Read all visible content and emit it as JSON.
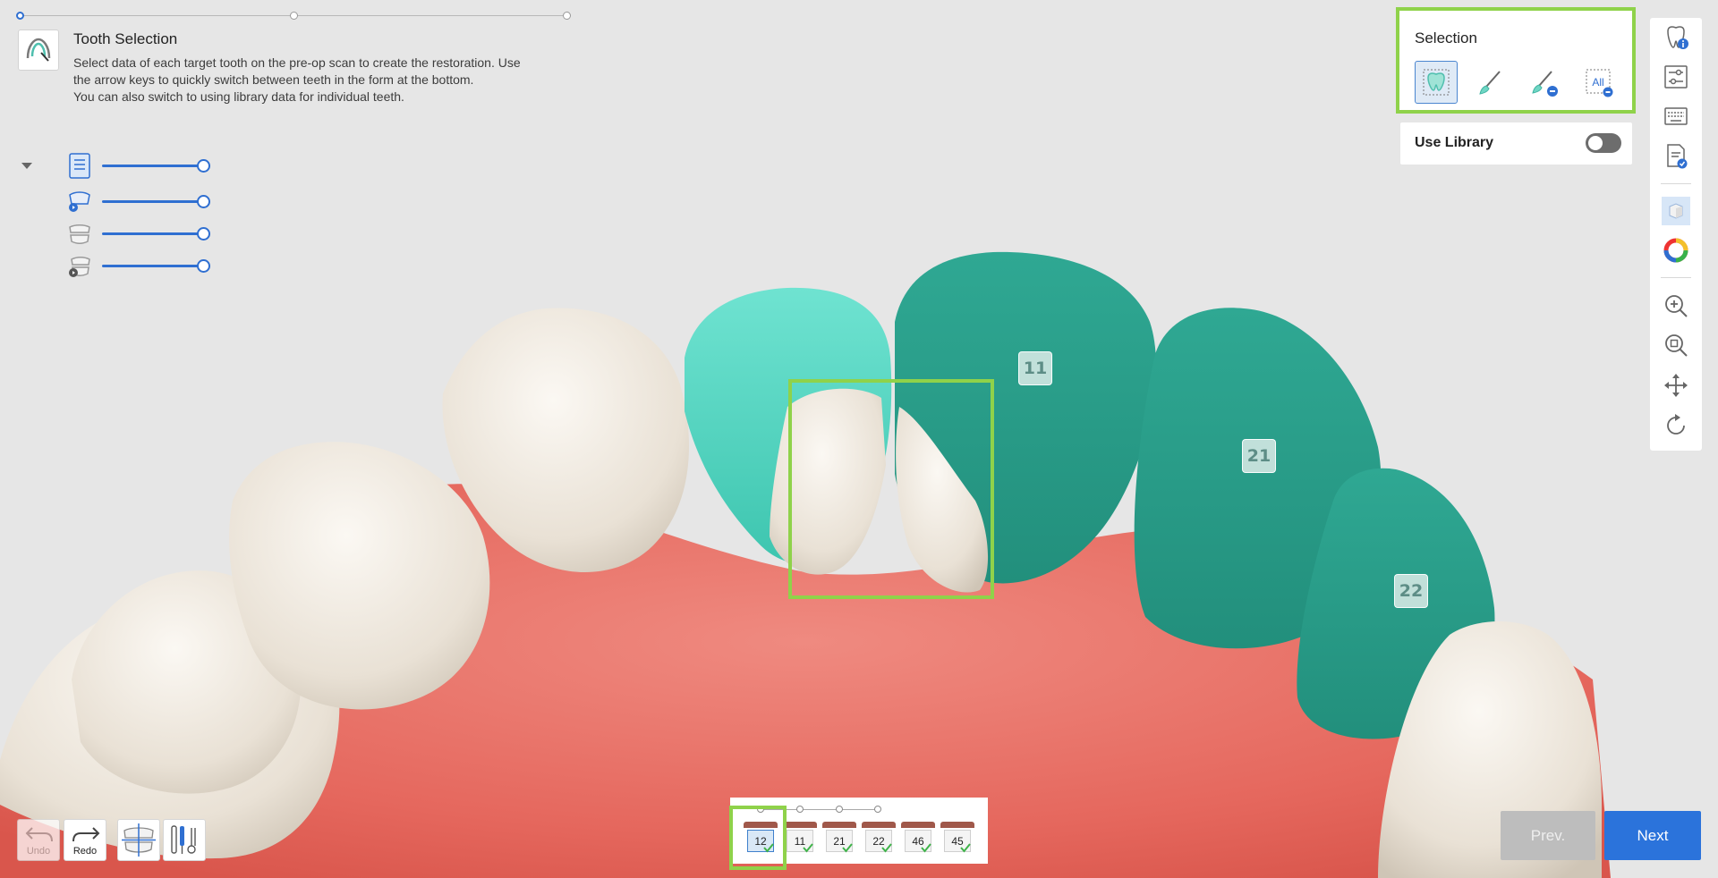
{
  "header": {
    "title": "Tooth Selection",
    "description": [
      "Select data of each target tooth on the pre-op scan to create the restoration. Use",
      "the arrow keys to quickly switch between teeth in the form at the bottom.",
      "You can also switch to using library data for individual teeth."
    ]
  },
  "step_progress": {
    "total_steps": 3,
    "current_step": 1
  },
  "layers": {
    "items": [
      {
        "icon": "pre-op-scan-icon",
        "opacity_percent": 100
      },
      {
        "icon": "upper-jaw-scan-icon",
        "opacity_percent": 100
      },
      {
        "icon": "lower-jaw-icon",
        "opacity_percent": 100
      },
      {
        "icon": "lower-jaw-scan-icon",
        "opacity_percent": 100
      }
    ]
  },
  "selection_panel": {
    "title": "Selection",
    "tools": [
      {
        "icon": "smart-select-icon",
        "active": true
      },
      {
        "icon": "brush-icon",
        "active": false
      },
      {
        "icon": "brush-erase-icon",
        "active": false
      },
      {
        "icon": "select-all-icon",
        "label": "All",
        "active": false
      }
    ]
  },
  "library": {
    "label": "Use Library",
    "enabled": false
  },
  "scene": {
    "tooth_labels": [
      "11",
      "21",
      "22"
    ]
  },
  "bottom_tools": {
    "undo_label": "Undo",
    "redo_label": "Redo"
  },
  "tooth_strip": {
    "teeth": [
      {
        "number": "12",
        "checked": true,
        "active": true
      },
      {
        "number": "11",
        "checked": true,
        "active": false
      },
      {
        "number": "21",
        "checked": true,
        "active": false
      },
      {
        "number": "22",
        "checked": true,
        "active": false
      },
      {
        "number": "46",
        "checked": true,
        "active": false
      },
      {
        "number": "45",
        "checked": true,
        "active": false
      }
    ]
  },
  "navigation": {
    "prev_label": "Prev.",
    "next_label": "Next"
  },
  "colors": {
    "accent": "#2b73db",
    "highlight": "#8fd24a",
    "selected_tooth": "#2a9d8a",
    "active_tooth": "#4fd1bd",
    "gum": "#e8766c",
    "tooth": "#ece4d8"
  }
}
